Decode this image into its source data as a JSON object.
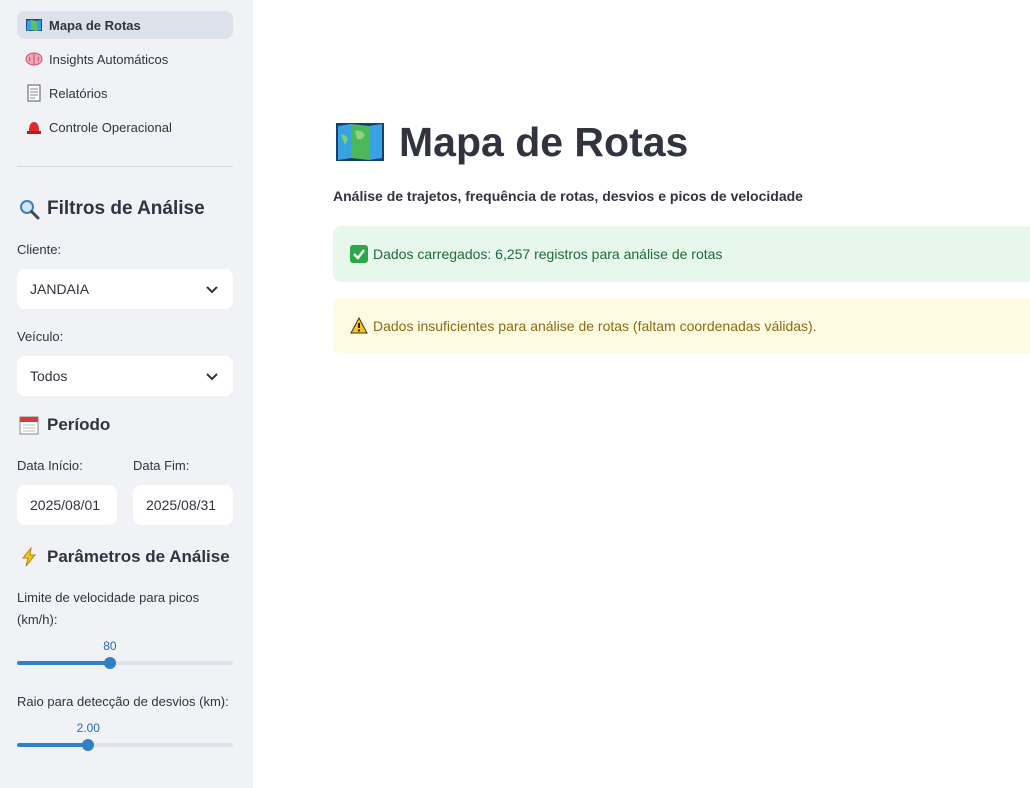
{
  "sidebar": {
    "nav": [
      {
        "label": "Mapa de Rotas",
        "icon": "map-icon",
        "active": true
      },
      {
        "label": "Insights Automáticos",
        "icon": "brain-icon",
        "active": false
      },
      {
        "label": "Relatórios",
        "icon": "document-icon",
        "active": false
      },
      {
        "label": "Controle Operacional",
        "icon": "siren-icon",
        "active": false
      }
    ],
    "filters": {
      "title": "Filtros de Análise",
      "client_label": "Cliente:",
      "client_value": "JANDAIA",
      "vehicle_label": "Veículo:",
      "vehicle_value": "Todos"
    },
    "period": {
      "title": "Período",
      "start_label": "Data Início:",
      "start_value": "2025/08/01",
      "end_label": "Data Fim:",
      "end_value": "2025/08/31"
    },
    "params": {
      "title": "Parâmetros de Análise",
      "speed_label": "Limite de velocidade para picos (km/h):",
      "speed_value": "80",
      "speed_fraction": 0.43,
      "radius_label": "Raio para detecção de desvios (km):",
      "radius_value": "2.00",
      "radius_fraction": 0.33
    }
  },
  "main": {
    "title": "Mapa de Rotas",
    "subtitle": "Análise de trajetos, frequência de rotas, desvios e picos de velocidade",
    "success_text": "Dados carregados: 6,257 registros para análise de rotas",
    "warning_text": "Dados insuficientes para análise de rotas (faltam coordenadas válidas)."
  },
  "colors": {
    "accent": "#2f80c6",
    "sidebar_bg": "#f0f2f6",
    "success_bg": "#e8f7ec",
    "success_text": "#1f6b3a",
    "warning_bg": "#fffbe3",
    "warning_text": "#8a6b12"
  }
}
